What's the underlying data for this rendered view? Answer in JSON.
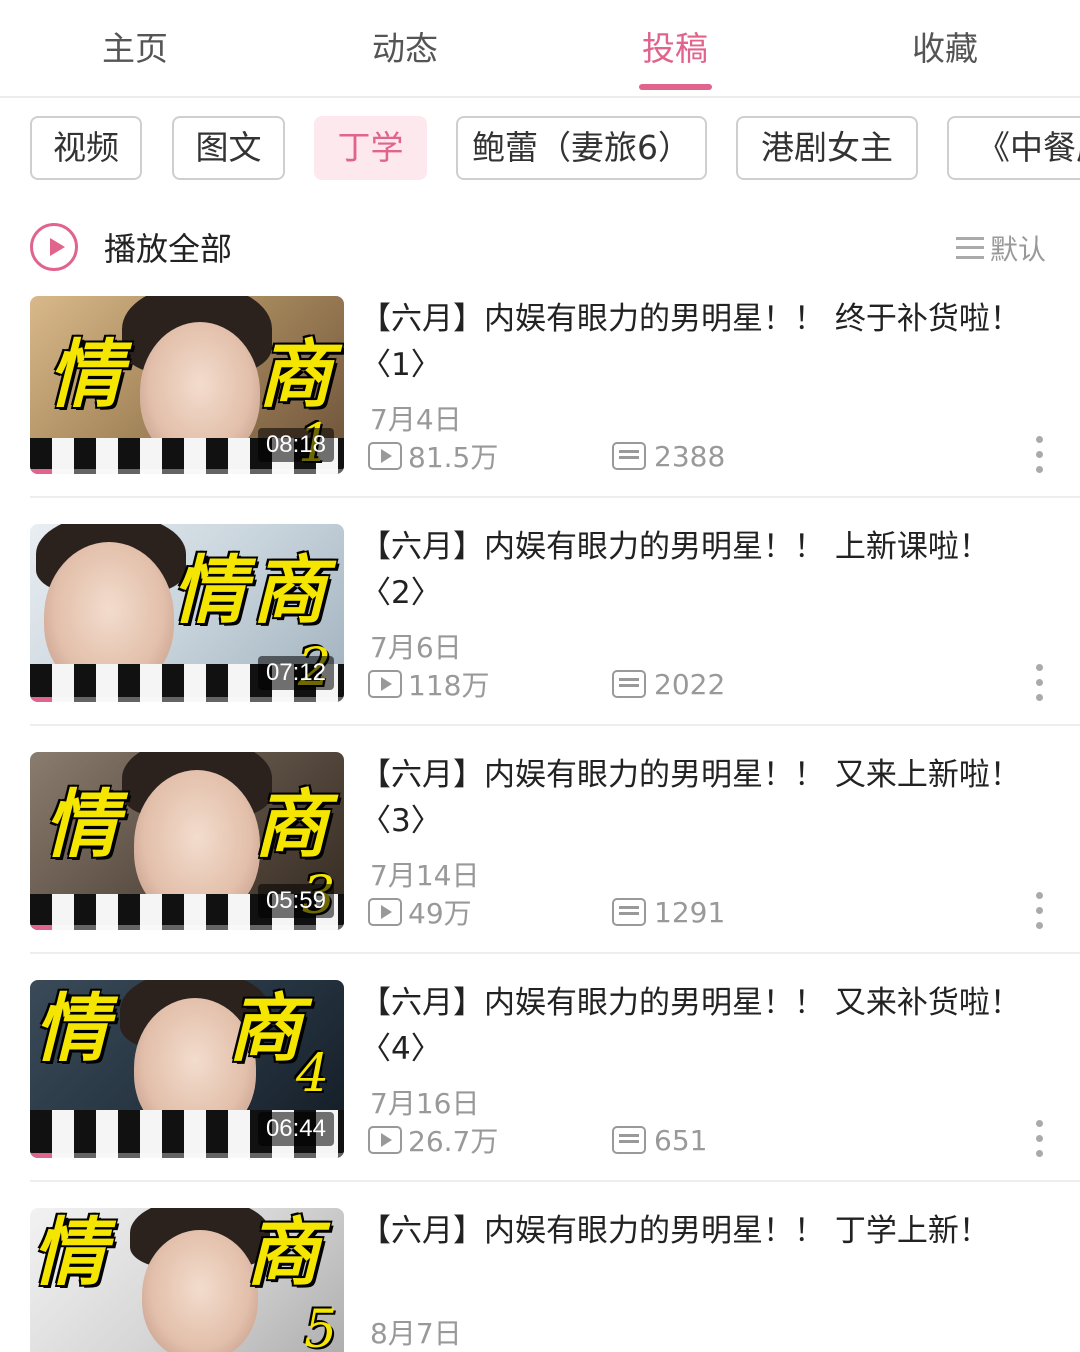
{
  "tabs": [
    {
      "label": "主页"
    },
    {
      "label": "动态"
    },
    {
      "label": "投稿"
    },
    {
      "label": "收藏"
    }
  ],
  "active_tab": "投稿",
  "chips": [
    {
      "label": "视频"
    },
    {
      "label": "图文"
    },
    {
      "label": "丁学"
    },
    {
      "label": "鲍蕾（妻旅6）"
    },
    {
      "label": "港剧女主"
    },
    {
      "label": "《中餐厅"
    }
  ],
  "active_chip": "丁学",
  "play_all": {
    "label": "播放全部"
  },
  "sort": {
    "label": "默认"
  },
  "colors": {
    "accent": "#e0648c",
    "muted": "#999999"
  },
  "thumbnail_word_left": "情",
  "thumbnail_word_right": "商",
  "videos": [
    {
      "title": "【六月】内娱有眼力的男明星！！ 终于补货啦！〈1〉",
      "date": "7月4日",
      "views": "81.5万",
      "danmaku": "2388",
      "duration": "08:18",
      "num": "1"
    },
    {
      "title": "【六月】内娱有眼力的男明星！！ 上新课啦！〈2〉",
      "date": "7月6日",
      "views": "118万",
      "danmaku": "2022",
      "duration": "07:12",
      "num": "2"
    },
    {
      "title": "【六月】内娱有眼力的男明星！！ 又来上新啦！〈3〉",
      "date": "7月14日",
      "views": "49万",
      "danmaku": "1291",
      "duration": "05:59",
      "num": "3"
    },
    {
      "title": "【六月】内娱有眼力的男明星！！ 又来补货啦！〈4〉",
      "date": "7月16日",
      "views": "26.7万",
      "danmaku": "651",
      "duration": "06:44",
      "num": "4"
    },
    {
      "title": "【六月】内娱有眼力的男明星！！ 丁学上新！",
      "date": "8月7日",
      "num": "5"
    }
  ]
}
